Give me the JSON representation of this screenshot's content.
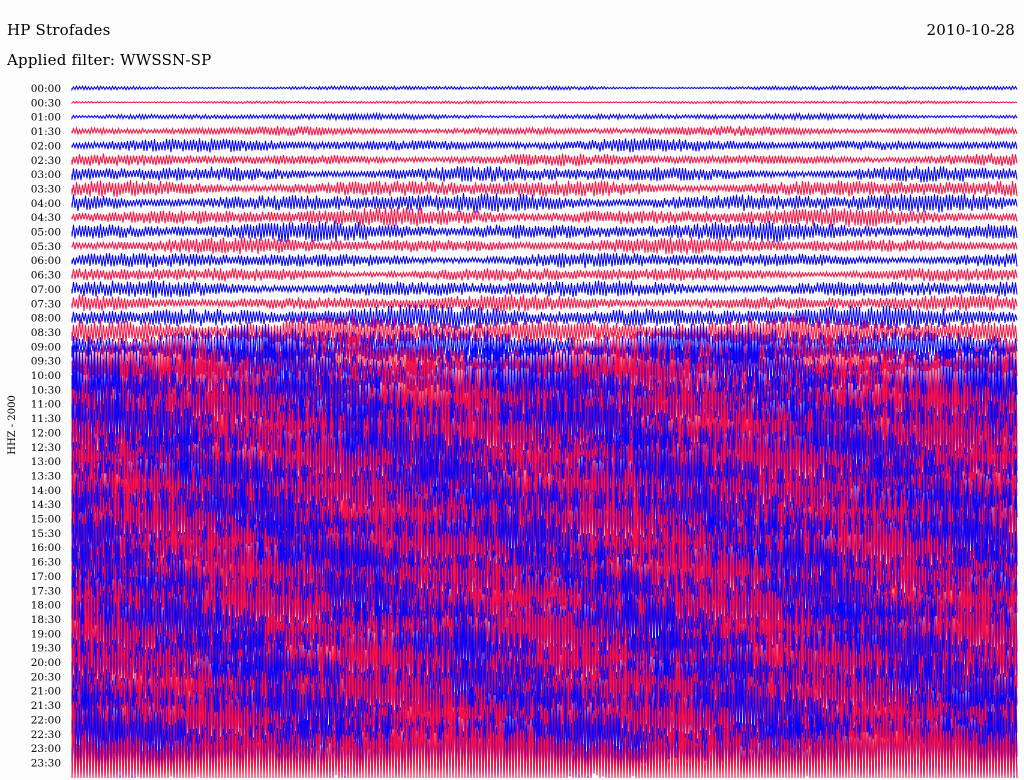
{
  "header": {
    "station": "HP Strofades",
    "date": "2010-10-28",
    "filter": "Applied filter: WWSSN-SP"
  },
  "chart_data": {
    "type": "line",
    "ylabel": "HHZ - 2000",
    "row_labels": [
      "00:00",
      "00:30",
      "01:00",
      "01:30",
      "02:00",
      "02:30",
      "03:00",
      "03:30",
      "04:00",
      "04:30",
      "05:00",
      "05:30",
      "06:00",
      "06:30",
      "07:00",
      "07:30",
      "08:00",
      "08:30",
      "09:00",
      "09:30",
      "10:00",
      "10:30",
      "11:00",
      "11:30",
      "12:00",
      "12:30",
      "13:00",
      "13:30",
      "14:00",
      "14:30",
      "15:00",
      "15:30",
      "16:00",
      "16:30",
      "17:00",
      "17:30",
      "18:00",
      "18:30",
      "19:00",
      "19:30",
      "20:00",
      "20:30",
      "21:00",
      "21:30",
      "22:00",
      "22:30",
      "23:00",
      "23:30"
    ],
    "amplitude": [
      0.2,
      0.15,
      0.3,
      0.45,
      0.65,
      0.6,
      0.8,
      0.85,
      0.95,
      0.9,
      1.0,
      0.8,
      0.75,
      0.7,
      0.85,
      0.8,
      1.2,
      1.6,
      2.2,
      2.8,
      4.2,
      4.6,
      4.8,
      5.0,
      5.0,
      5.0,
      5.0,
      5.0,
      5.0,
      5.0,
      5.0,
      5.0,
      5.0,
      5.0,
      5.0,
      5.0,
      5.0,
      5.0,
      5.0,
      5.0,
      5.0,
      5.0,
      5.0,
      5.0,
      5.0,
      5.0,
      5.0,
      5.0
    ],
    "colors": [
      "#0000ff",
      "#ff1040"
    ],
    "grid": false
  }
}
